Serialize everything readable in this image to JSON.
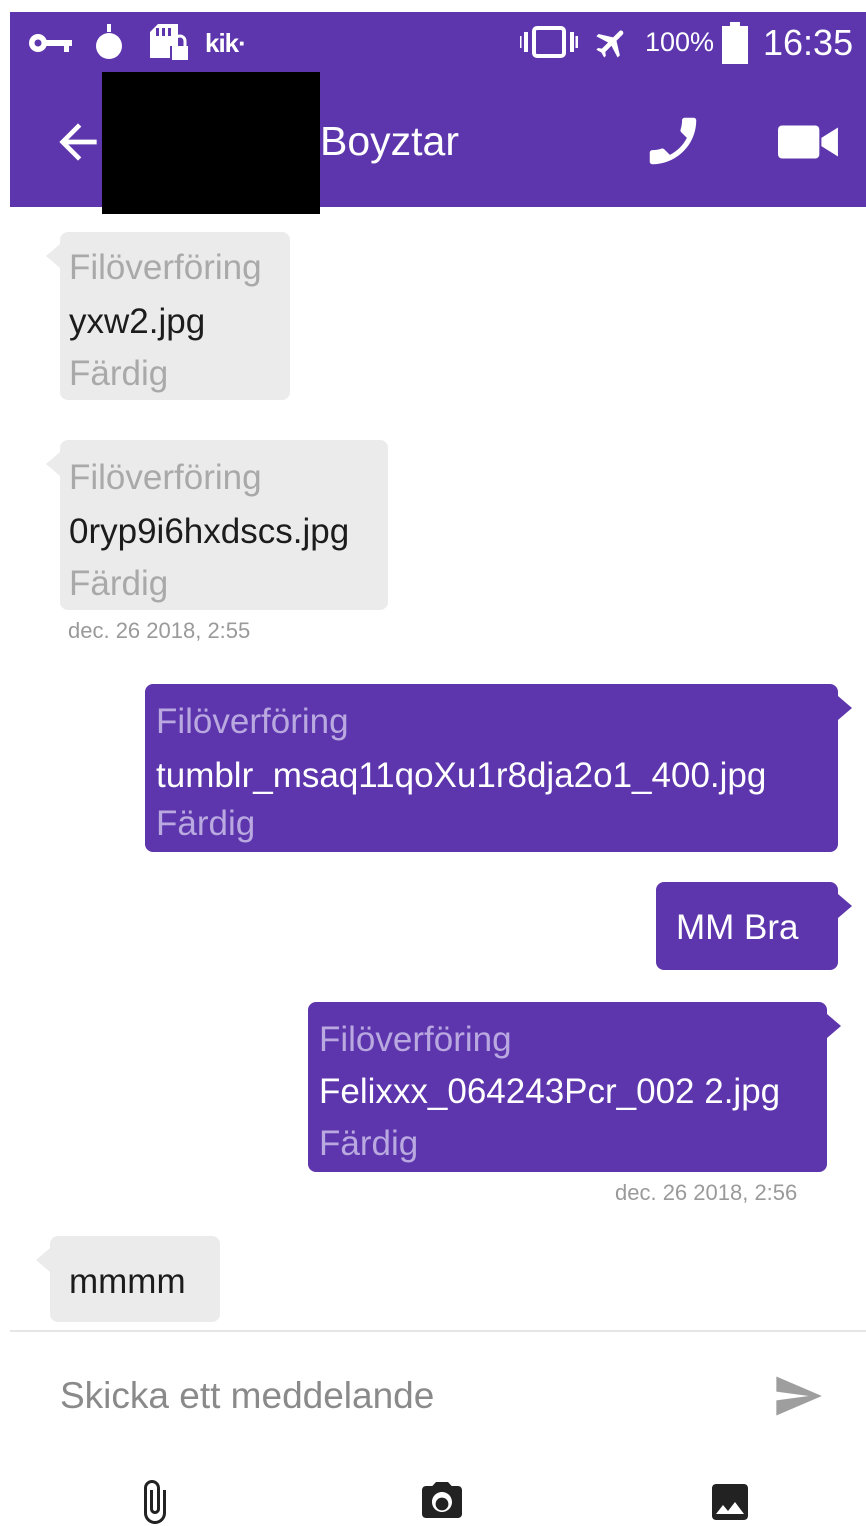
{
  "status_bar": {
    "icons": [
      "vpn-key-icon",
      "drop-icon",
      "sd-card-locked-icon",
      "kik-notification-icon",
      "vibrate-icon",
      "airplane-mode-icon",
      "battery-icon"
    ],
    "kik_label": "kik·",
    "battery_text": "100%",
    "time": "16:35"
  },
  "app_bar": {
    "contact_name": "Boyztar",
    "color": "#5d36ad"
  },
  "messages": [
    {
      "direction": "incoming",
      "type": "file_transfer",
      "label": "Filöverföring",
      "filename": "yxw2.jpg",
      "status": "Färdig"
    },
    {
      "direction": "incoming",
      "type": "file_transfer",
      "label": "Filöverföring",
      "filename": "0ryp9i6hxdscs.jpg",
      "status": "Färdig",
      "timestamp": "dec. 26 2018,  2:55"
    },
    {
      "direction": "outgoing",
      "type": "file_transfer",
      "label": "Filöverföring",
      "filename": "tumblr_msaq11qoXu1r8dja2o1_400.jpg",
      "status": "Färdig"
    },
    {
      "direction": "outgoing",
      "type": "text",
      "text": "MM Bra"
    },
    {
      "direction": "outgoing",
      "type": "file_transfer",
      "label": "Filöverföring",
      "filename": "Felixxx_064243Pcr_002 2.jpg",
      "status": "Färdig",
      "timestamp": "dec. 26 2018,  2:56"
    },
    {
      "direction": "incoming",
      "type": "text",
      "text": "mmmm"
    }
  ],
  "composer": {
    "placeholder": "Skicka ett meddelande",
    "value": ""
  },
  "toolbar": {
    "icons": [
      "attach-icon",
      "camera-icon",
      "gallery-icon"
    ]
  }
}
